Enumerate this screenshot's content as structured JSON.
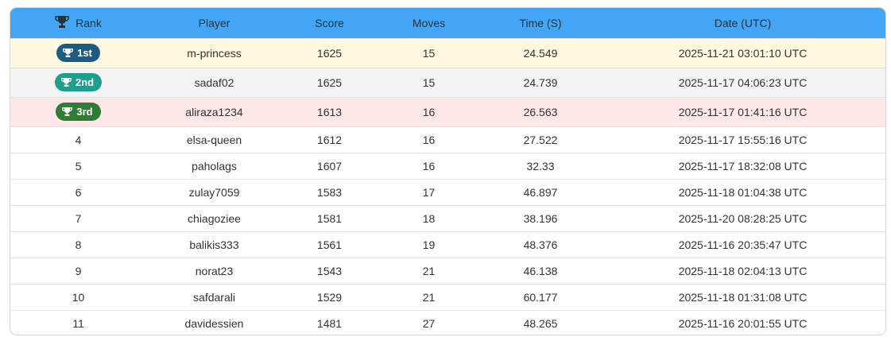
{
  "headers": {
    "rank": "Rank",
    "player": "Player",
    "score": "Score",
    "moves": "Moves",
    "time": "Time (S)",
    "date": "Date (UTC)"
  },
  "colors": {
    "header_bg": "#42a5f5",
    "badge_1st": "#1e5b80",
    "badge_2nd": "#1f9e8e",
    "badge_3rd": "#2e7d32",
    "row_1st_bg": "#fff8e1",
    "row_2nd_bg": "#f4f4f4",
    "row_3rd_bg": "#ffe6e9"
  },
  "icons": {
    "header": "trophy-icon",
    "badge": "trophy-icon"
  },
  "rows": [
    {
      "rank": "1st",
      "player": "m-princess",
      "score": "1625",
      "moves": "15",
      "time": "24.549",
      "date": "2025-11-21 03:01:10 UTC"
    },
    {
      "rank": "2nd",
      "player": "sadaf02",
      "score": "1625",
      "moves": "15",
      "time": "24.739",
      "date": "2025-11-17 04:06:23 UTC"
    },
    {
      "rank": "3rd",
      "player": "aliraza1234",
      "score": "1613",
      "moves": "16",
      "time": "26.563",
      "date": "2025-11-17 01:41:16 UTC"
    },
    {
      "rank": "4",
      "player": "elsa-queen",
      "score": "1612",
      "moves": "16",
      "time": "27.522",
      "date": "2025-11-17 15:55:16 UTC"
    },
    {
      "rank": "5",
      "player": "paholags",
      "score": "1607",
      "moves": "16",
      "time": "32.33",
      "date": "2025-11-17 18:32:08 UTC"
    },
    {
      "rank": "6",
      "player": "zulay7059",
      "score": "1583",
      "moves": "17",
      "time": "46.897",
      "date": "2025-11-18 01:04:38 UTC"
    },
    {
      "rank": "7",
      "player": "chiagoziee",
      "score": "1581",
      "moves": "18",
      "time": "38.196",
      "date": "2025-11-20 08:28:25 UTC"
    },
    {
      "rank": "8",
      "player": "balikis333",
      "score": "1561",
      "moves": "19",
      "time": "48.376",
      "date": "2025-11-16 20:35:47 UTC"
    },
    {
      "rank": "9",
      "player": "norat23",
      "score": "1543",
      "moves": "21",
      "time": "46.138",
      "date": "2025-11-18 02:04:13 UTC"
    },
    {
      "rank": "10",
      "player": "safdarali",
      "score": "1529",
      "moves": "21",
      "time": "60.177",
      "date": "2025-11-18 01:31:08 UTC"
    },
    {
      "rank": "11",
      "player": "davidessien",
      "score": "1481",
      "moves": "27",
      "time": "48.265",
      "date": "2025-11-16 20:01:55 UTC"
    }
  ]
}
